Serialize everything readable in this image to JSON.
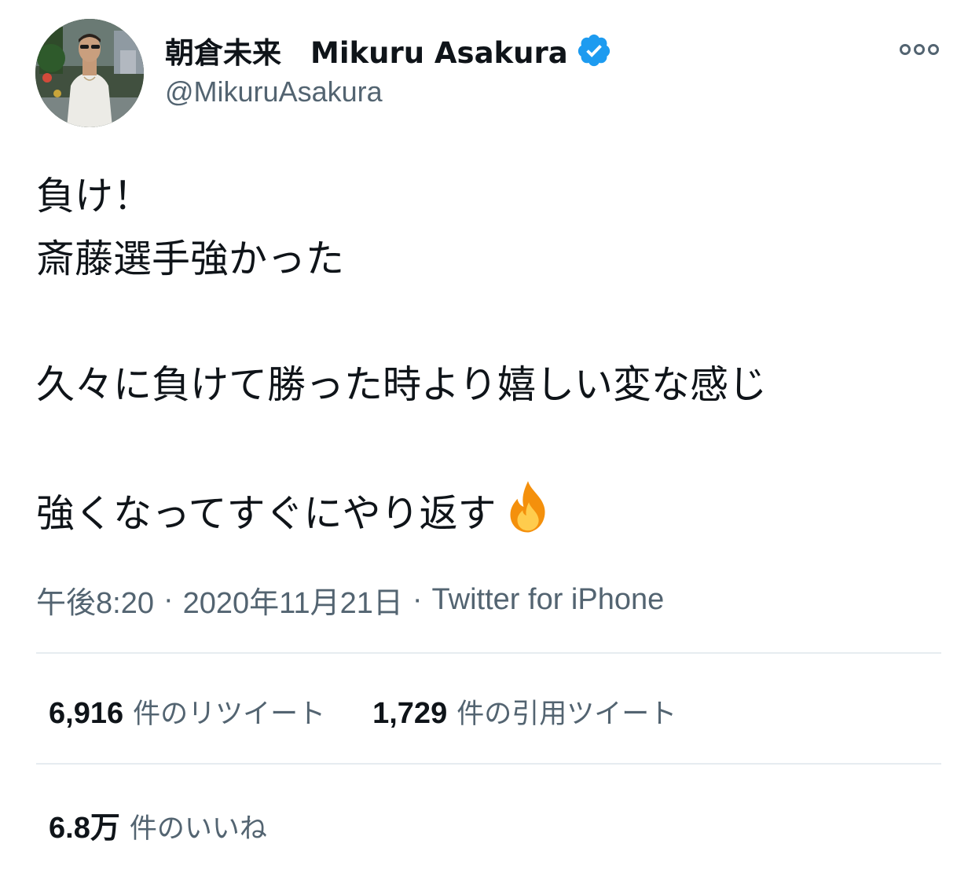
{
  "user": {
    "display_name": "朝倉未来　Mikuru Asakura",
    "handle": "@MikuruAsakura",
    "verified": true,
    "avatar_icon": "profile-photo"
  },
  "tweet": {
    "lines": [
      "負け！",
      "斎藤選手強かった",
      "",
      "久々に負けて勝った時より嬉しい変な感じ",
      "",
      "強くなってすぐにやり返す"
    ],
    "emoji": "fire-icon"
  },
  "meta": {
    "time": "午後8:20",
    "date": "2020年11月21日",
    "source": "Twitter for iPhone",
    "separator": "·"
  },
  "stats": {
    "retweets": {
      "count": "6,916",
      "label": "件のリツイート"
    },
    "quotes": {
      "count": "1,729",
      "label": "件の引用ツイート"
    },
    "likes": {
      "count": "6.8万",
      "label": "件のいいね"
    }
  },
  "colors": {
    "text": "#0f1419",
    "secondary": "#536471",
    "verified": "#1d9bf0",
    "divider": "#e6ecf0"
  }
}
